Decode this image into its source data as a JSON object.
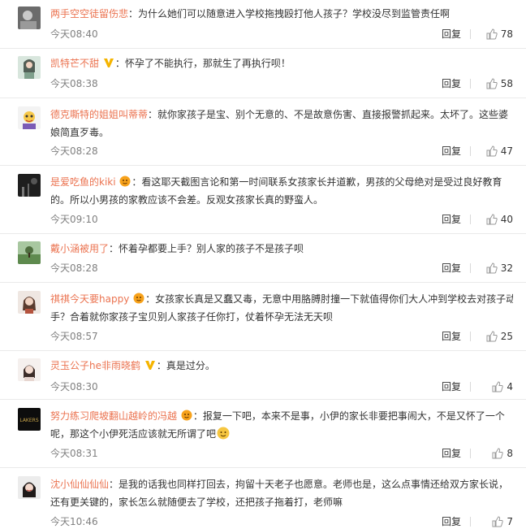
{
  "colors": {
    "username": "#eb7350",
    "text": "#333333",
    "meta": "#808080"
  },
  "comments": [
    {
      "user": "两手空空徒留伤悲",
      "badge": "",
      "line1": "为什么她们可以随意进入学校拖拽殴打他人孩子？学校没尽到监管责任啊",
      "line2": "",
      "time": "今天08:40",
      "reply": "回复",
      "likes": "78"
    },
    {
      "user": "凯特芒不甜",
      "badge": "verified-icon",
      "line1": "怀孕了不能执行，那就生了再执行呗！",
      "line2": "",
      "time": "今天08:38",
      "reply": "回复",
      "likes": "58"
    },
    {
      "user": "德克嘶特的姐姐叫蒂蒂",
      "badge": "",
      "line1": "就你家孩子是宝、别个无意的、不是故意伤害、直接报警抓起来。太坏了。这些婆",
      "line2": "娘简直歹毒。",
      "time": "今天08:28",
      "reply": "回复",
      "likes": "47"
    },
    {
      "user": "是爱吃鱼的kiki",
      "badge": "member-icon",
      "line1": "看这耶天截图言论和第一时间联系女孩家长并道歉，男孩的父母绝对是受过良好教育",
      "line2": "的。所以小男孩的家教应该不会差。反观女孩家长真的野蛮人。",
      "time": "今天09:10",
      "reply": "回复",
      "likes": "40"
    },
    {
      "user": "戴小涵被用了",
      "badge": "",
      "line1": "怀着孕都要上手？别人家的孩子不是孩子呗",
      "line2": "",
      "time": "今天08:28",
      "reply": "回复",
      "likes": "32"
    },
    {
      "user": "祺祺今天要happy",
      "badge": "member-icon",
      "line1": "女孩家长真是又蠢又毒，无意中用胳膊肘撞一下就值得你们大人冲到学校去对孩子动",
      "line2": "手？合着就你家孩子宝贝别人家孩子任你打，仗着怀孕无法无天呗",
      "time": "今天08:57",
      "reply": "回复",
      "likes": "25"
    },
    {
      "user": "灵玉公子he非雨晓鹤",
      "badge": "verified-icon",
      "line1": "真是过分。",
      "line2": "",
      "time": "今天08:30",
      "reply": "回复",
      "likes": "4"
    },
    {
      "user": "努力练习爬坡翻山越岭的冯越",
      "badge": "member-icon",
      "line1": "报复一下吧，本来不是事，小伊的家长非要把事闹大，不是又怀了一个",
      "line2": "呢，那这个小伊死活应该就无所谓了吧",
      "emoji": "smile-emoji-icon",
      "time": "今天08:31",
      "reply": "回复",
      "likes": "8"
    },
    {
      "user": "沈小仙仙仙仙",
      "badge": "",
      "line1": "是我的话我也同样打回去，拘留十天老子也愿意。老师也是，这么点事情还给双方家长说，",
      "line2": "还有更关键的，家长怎么就随便去了学校，还把孩子拖着打，老师嘛",
      "time": "今天10:46",
      "reply": "回复",
      "likes": "7"
    }
  ]
}
